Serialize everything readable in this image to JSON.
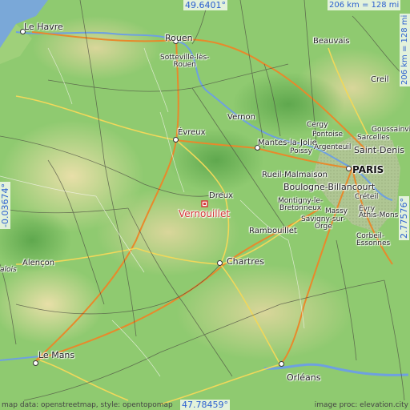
{
  "map": {
    "latitude_top": "49.6401°",
    "latitude_bottom": "47.78459°",
    "longitude_left": "-0.03674°",
    "longitude_right": "2.77576°",
    "scale_top": "206 km = 128 mi",
    "scale_right": "206 km = 128 mi",
    "marker_label": "Vernouillet",
    "attribution_left": "map data: openstreetmap, style: opentopomap",
    "attribution_right": "image proc: elevation.city",
    "colors": {
      "marker": "#d53737",
      "coord_text": "#2a5fd0",
      "river": "#6ea0e0",
      "sea": "#7aa8d8"
    }
  },
  "places": {
    "le_havre": "Le Havre",
    "rouen": "Rouen",
    "beauvais": "Beauvais",
    "sotteville": "Sotteville-lès-\nRouen",
    "creil": "Creil",
    "paris": "PARIS",
    "sarcelles": "Sarcelles",
    "goussainville": "Goussainville",
    "evreux": "Évreux",
    "vernon": "Vernon",
    "cergy": "Cergy",
    "pontoise": "Pontoise",
    "mantes": "Mantes-la-Jolie",
    "poissy": "Poissy",
    "argenteuil": "Argenteuil",
    "saint_denis": "Saint-Denis",
    "rueil": "Rueil-Malmaison",
    "boulogne": "Boulogne-Billancourt",
    "creteil": "Créteil",
    "dreux": "Dreux",
    "montigny": "Montigny-le-\nBretonneux",
    "massy": "Massy",
    "savigny": "Savigny-sur-\nOrge",
    "evry": "Évry",
    "athis": "Athis-Mons",
    "rambouillet": "Rambouillet",
    "corbeil": "Corbeil-\nEssonnes",
    "chartres": "Chartres",
    "alencon": "Alençon",
    "alois": "alois",
    "le_mans": "Le Mans",
    "orleans": "Orléans"
  }
}
